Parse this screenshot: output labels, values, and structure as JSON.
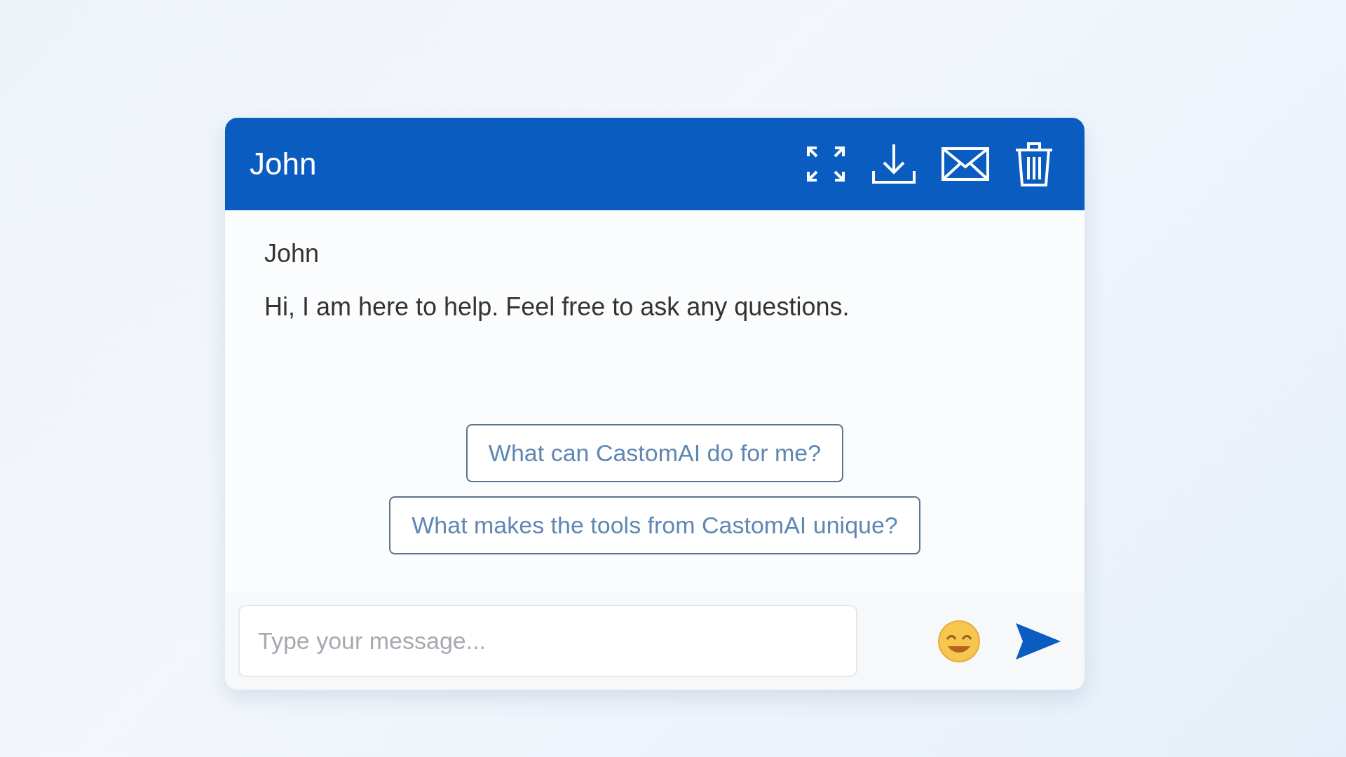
{
  "header": {
    "title": "John"
  },
  "message": {
    "sender": "John",
    "text": "Hi, I am here to help. Feel free to ask any questions."
  },
  "suggestions": [
    "What can CastomAI do for me?",
    "What makes the tools from CastomAI unique?"
  ],
  "composer": {
    "placeholder": "Type your message..."
  }
}
